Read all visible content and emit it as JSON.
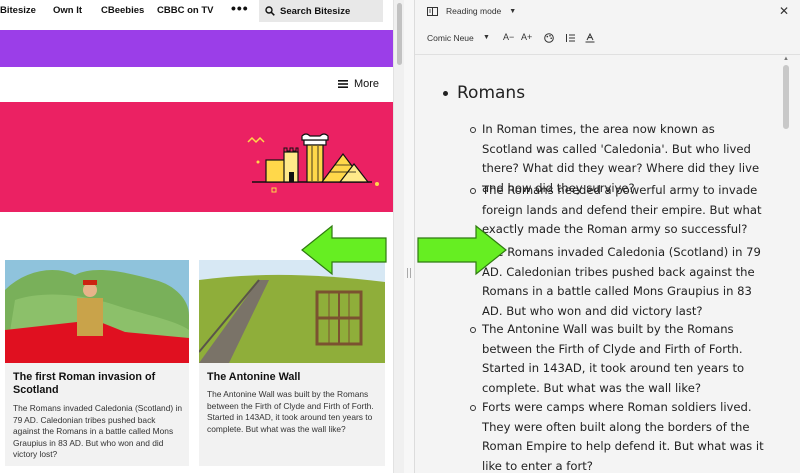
{
  "nav": {
    "items": [
      "Bitesize",
      "Own It",
      "CBeebies",
      "CBBC on TV"
    ],
    "more_dots": "•••",
    "search_label": "Search Bitesize"
  },
  "header": {
    "more_label": "More"
  },
  "cards": [
    {
      "title": "The first Roman invasion of Scotland",
      "text": "The Romans invaded Caledonia (Scotland) in 79 AD. Caledonian tribes pushed back against the Romans in a battle called Mons Graupius in 83 AD. But who won and did victory lost?"
    },
    {
      "title": "The Antonine Wall",
      "text": "The Antonine Wall was built by the Romans between the Firth of Clyde and Firth of Forth. Started in 143AD, it took around ten years to complete. But what was the wall like?"
    }
  ],
  "reader": {
    "mode_label": "Reading mode",
    "close_icon": "✕",
    "font_name": "Comic Neue",
    "toolbar": {
      "decrease": "A−",
      "increase": "A+",
      "theme_icon": "palette-icon",
      "spacing_icon": "line-spacing-icon",
      "letter_icon": "letter-spacing-icon"
    },
    "heading": "Romans",
    "paragraphs": [
      "In Roman times, the area now known as Scotland was called 'Caledonia'. But who lived there? What did they wear? Where did they live and how did they survive?",
      "The Romans needed a powerful army to invade foreign lands and defend their empire. But what exactly made the Roman army so successful?",
      "The Romans invaded Caledonia (Scotland) in 79 AD. Caledonian tribes pushed back against the Romans in a battle called Mons Graupius in 83 AD. But who won and did victory last?",
      "The Antonine Wall was built by the Romans between the Firth of Clyde and Firth of Forth. Started in 143AD, it took around ten years to complete. But what was the wall like?",
      "Forts were camps where Roman soldiers lived. They were often built along the borders of the Roman Empire to help defend it. But what was it like to enter a fort?"
    ]
  },
  "colors": {
    "purple": "#9b3ee8",
    "pink": "#eb2163",
    "arrow": "#66ee22"
  }
}
